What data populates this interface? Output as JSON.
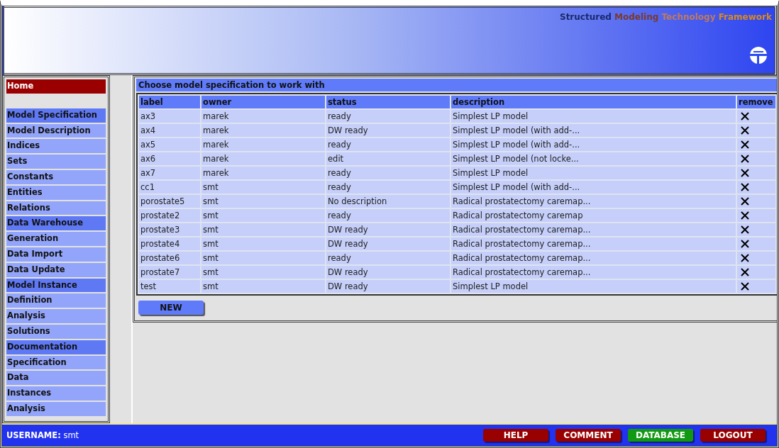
{
  "header": {
    "title_words": [
      {
        "text": "Structured",
        "color": "#1a2a6a"
      },
      {
        "text": "Modeling",
        "color": "#7a3a2a"
      },
      {
        "text": "Technology",
        "color": "#c07a5a"
      },
      {
        "text": "Framework",
        "color": "#d98a1a"
      }
    ]
  },
  "sidebar": {
    "items": [
      {
        "label": "Home",
        "kind": "home",
        "selected": true
      },
      {
        "label": "Model Specification",
        "kind": "section",
        "selected": false
      },
      {
        "label": "Model Description",
        "kind": "item",
        "selected": false
      },
      {
        "label": "Indices",
        "kind": "item",
        "selected": false
      },
      {
        "label": "Sets",
        "kind": "item",
        "selected": false
      },
      {
        "label": "Constants",
        "kind": "item",
        "selected": false
      },
      {
        "label": "Entities",
        "kind": "item",
        "selected": false
      },
      {
        "label": "Relations",
        "kind": "item",
        "selected": false
      },
      {
        "label": "Data Warehouse",
        "kind": "section",
        "selected": false
      },
      {
        "label": "Generation",
        "kind": "item",
        "selected": false
      },
      {
        "label": "Data Import",
        "kind": "item",
        "selected": false
      },
      {
        "label": "Data Update",
        "kind": "item",
        "selected": false
      },
      {
        "label": "Model Instance",
        "kind": "section",
        "selected": false
      },
      {
        "label": "Definition",
        "kind": "item",
        "selected": false
      },
      {
        "label": "Analysis",
        "kind": "item",
        "selected": false
      },
      {
        "label": "Solutions",
        "kind": "item",
        "selected": false
      },
      {
        "label": "Documentation",
        "kind": "section",
        "selected": false
      },
      {
        "label": "Specification",
        "kind": "item",
        "selected": false
      },
      {
        "label": "Data",
        "kind": "item",
        "selected": false
      },
      {
        "label": "Instances",
        "kind": "item",
        "selected": false
      },
      {
        "label": "Analysis",
        "kind": "item",
        "selected": false
      }
    ]
  },
  "panel": {
    "title": "Choose model specification to work with",
    "table": {
      "columns": [
        "label",
        "owner",
        "status",
        "description",
        "remove"
      ],
      "rows": [
        [
          "ax3",
          "marek",
          "ready",
          "Simplest LP model"
        ],
        [
          "ax4",
          "marek",
          "DW ready",
          "Simplest LP model (with add-..."
        ],
        [
          "ax5",
          "marek",
          "ready",
          "Simplest LP model (with add-..."
        ],
        [
          "ax6",
          "marek",
          "edit",
          "Simplest LP model (not locke..."
        ],
        [
          "ax7",
          "marek",
          "ready",
          "Simplest LP model"
        ],
        [
          "cc1",
          "smt",
          "ready",
          "Simplest LP model (with add-..."
        ],
        [
          "porostate5",
          "smt",
          "No description",
          "Radical prostatectomy caremap..."
        ],
        [
          "prostate2",
          "smt",
          "ready",
          "Radical prostatectomy caremap"
        ],
        [
          "prostate3",
          "smt",
          "DW ready",
          "Radical prostatectomy caremap..."
        ],
        [
          "prostate4",
          "smt",
          "DW ready",
          "Radical prostatectomy caremap..."
        ],
        [
          "prostate6",
          "smt",
          "ready",
          "Radical prostatectomy caremap..."
        ],
        [
          "prostate7",
          "smt",
          "DW ready",
          "Radical prostatectomy caremap..."
        ],
        [
          "test",
          "smt",
          "DW ready",
          "Simplest LP model"
        ]
      ]
    },
    "new_button": "NEW"
  },
  "footer": {
    "username_label": "USERNAME:",
    "username": "smt",
    "buttons": [
      {
        "label": "HELP",
        "color": "#990000"
      },
      {
        "label": "COMMENT",
        "color": "#990000"
      },
      {
        "label": "DATABASE",
        "color": "#119911"
      },
      {
        "label": "LOGOUT",
        "color": "#990000"
      }
    ]
  }
}
